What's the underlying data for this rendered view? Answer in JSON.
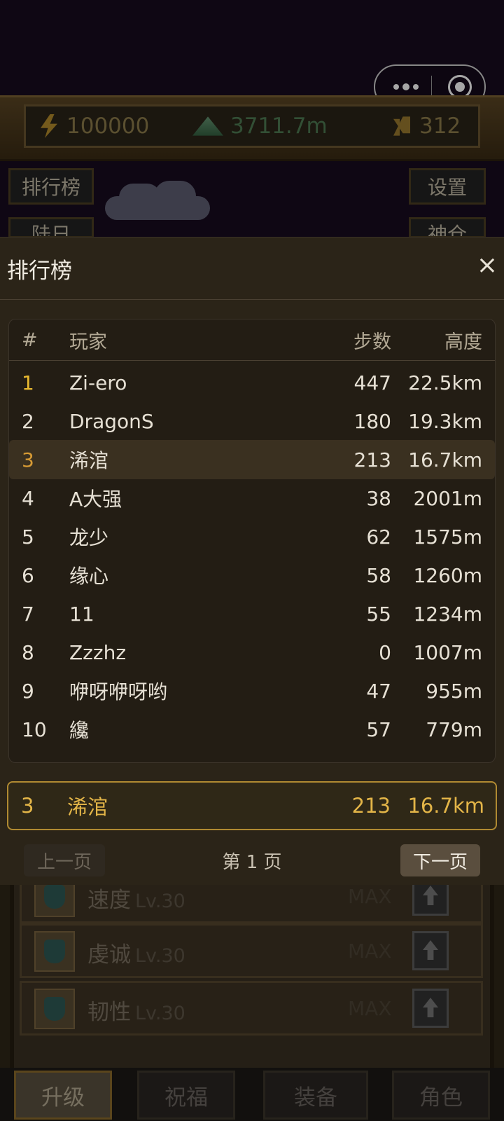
{
  "hud": {
    "energy": "100000",
    "height": "3711.7m",
    "steps": "312"
  },
  "side_buttons": {
    "leaderboard": "排行榜",
    "settings": "设置",
    "left_partial": "陆日",
    "right_partial": "神仓"
  },
  "leaderboard": {
    "title": "排行榜",
    "close_icon": "×",
    "headers": {
      "rank": "#",
      "player": "玩家",
      "steps": "步数",
      "height": "高度"
    },
    "rows": [
      {
        "rank": "1",
        "name": "Zi-ero",
        "steps": "447",
        "height": "22.5km"
      },
      {
        "rank": "2",
        "name": "DragonS",
        "steps": "180",
        "height": "19.3km"
      },
      {
        "rank": "3",
        "name": "浠涫",
        "steps": "213",
        "height": "16.7km"
      },
      {
        "rank": "4",
        "name": "A大强",
        "steps": "38",
        "height": "2001m"
      },
      {
        "rank": "5",
        "name": "龙少",
        "steps": "62",
        "height": "1575m"
      },
      {
        "rank": "6",
        "name": "缘心",
        "steps": "58",
        "height": "1260m"
      },
      {
        "rank": "7",
        "name": "11",
        "steps": "55",
        "height": "1234m"
      },
      {
        "rank": "8",
        "name": "Zzzhz",
        "steps": "0",
        "height": "1007m"
      },
      {
        "rank": "9",
        "name": "咿呀咿呀哟",
        "steps": "47",
        "height": "955m"
      },
      {
        "rank": "10",
        "name": "纔",
        "steps": "57",
        "height": "779m"
      }
    ],
    "my_entry": {
      "rank": "3",
      "name": "浠涫",
      "steps": "213",
      "height": "16.7km"
    },
    "pager": {
      "prev": "上一页",
      "page_label": "第 1 页",
      "next": "下一页"
    }
  },
  "upgrades": [
    {
      "name": "速度",
      "level": "Lv.30",
      "state": "MAX"
    },
    {
      "name": "虔诚",
      "level": "Lv.30",
      "state": "MAX"
    },
    {
      "name": "韧性",
      "level": "Lv.30",
      "state": "MAX"
    }
  ],
  "tabs": [
    "升级",
    "祝福",
    "装备",
    "角色"
  ],
  "colors": {
    "panel_bg": "#2b2418",
    "gold_rank": "#e8b930",
    "highlight_border": "#b08a32"
  }
}
